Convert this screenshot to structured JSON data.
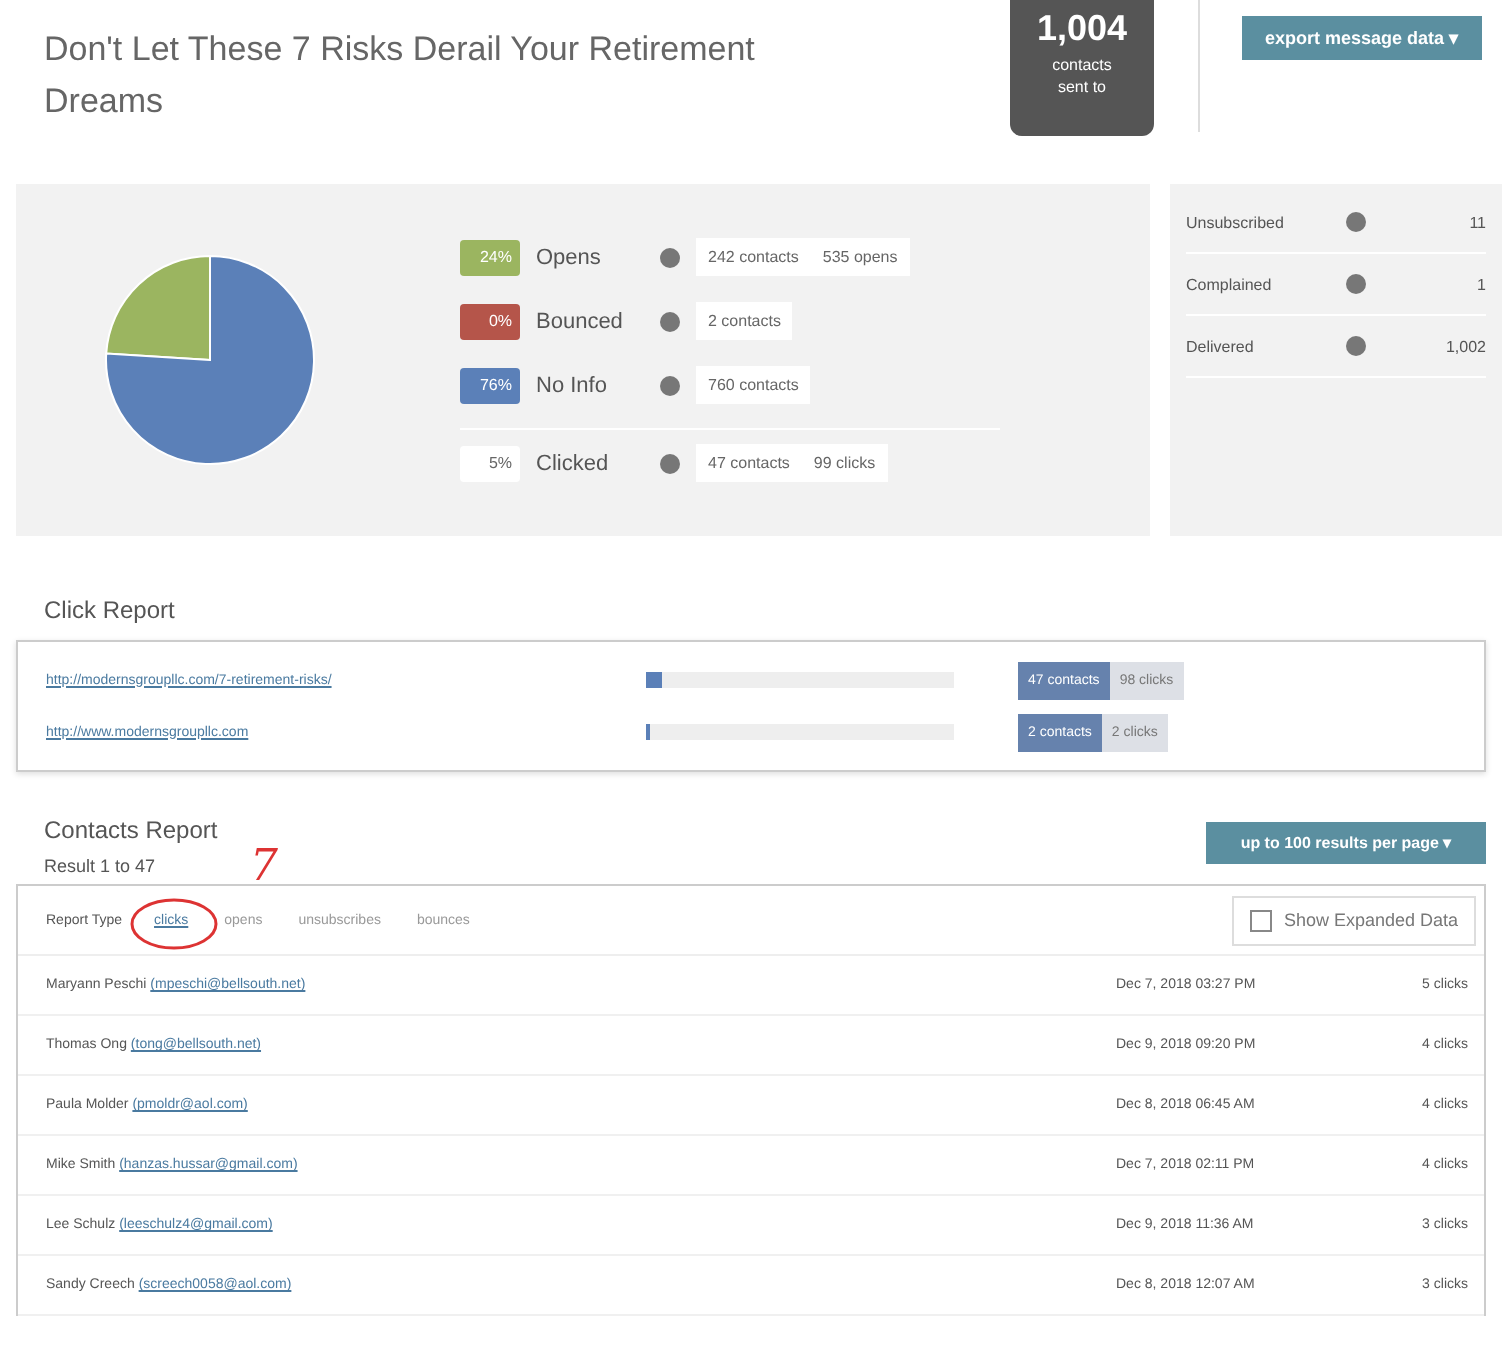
{
  "header": {
    "title": "Don't Let These 7 Risks Derail Your Retirement Dreams",
    "sent_count": "1,004",
    "sent_label": "contacts sent to",
    "export_button": "export message data ▾"
  },
  "stats": {
    "items": [
      {
        "kind": "segment",
        "badge": "24%",
        "label": "Opens",
        "color": "#9bb560",
        "chips": [
          "242 contacts",
          "535 opens"
        ]
      },
      {
        "kind": "segment",
        "badge": "0%",
        "label": "Bounced",
        "color": "#b5554a",
        "chips": [
          "2 contacts"
        ]
      },
      {
        "kind": "segment",
        "badge": "76%",
        "label": "No Info",
        "color": "#5b80b8",
        "chips": [
          "760 contacts"
        ]
      },
      {
        "kind": "extra",
        "badge": "5%",
        "label": "Clicked",
        "color": "#ffffff",
        "chips": [
          "47 contacts",
          "99 clicks"
        ]
      }
    ],
    "side": [
      {
        "label": "Unsubscribed",
        "value": "11"
      },
      {
        "label": "Complained",
        "value": "1"
      },
      {
        "label": "Delivered",
        "value": "1,002"
      }
    ]
  },
  "click_report": {
    "title": "Click Report",
    "rows": [
      {
        "url": "http://modernsgroupllc.com/7-retirement-risks/",
        "level": 0.05,
        "contacts": "47 contacts",
        "clicks": "98 clicks"
      },
      {
        "url": "http://www.modernsgroupllc.com",
        "level": 0.01,
        "contacts": "2 contacts",
        "clicks": "2 clicks"
      }
    ]
  },
  "contacts_report": {
    "title": "Contacts Report",
    "result": "Result 1 to 47",
    "per_page_button": "up to 100 results per page ▾",
    "report_type_label": "Report Type",
    "report_types": [
      {
        "label": "clicks",
        "selected": true
      },
      {
        "label": "opens",
        "selected": false
      },
      {
        "label": "unsubscribes",
        "selected": false
      },
      {
        "label": "bounces",
        "selected": false
      }
    ],
    "annotation": "7",
    "expanded": {
      "label": "Show Expanded Data",
      "checked": false
    },
    "rows": [
      {
        "name": "Maryann Peschi",
        "email": "(mpeschi@bellsouth.net)",
        "date": "Dec 7, 2018 03:27 PM",
        "count": "5 clicks"
      },
      {
        "name": "Thomas Ong",
        "email": "(tong@bellsouth.net)",
        "date": "Dec 9, 2018 09:20 PM",
        "count": "4 clicks"
      },
      {
        "name": "Paula Molder",
        "email": "(pmoldr@aol.com)",
        "date": "Dec 8, 2018 06:45 AM",
        "count": "4 clicks"
      },
      {
        "name": "Mike Smith",
        "email": "(hanzas.hussar@gmail.com)",
        "date": "Dec 7, 2018 02:11 PM",
        "count": "4 clicks"
      },
      {
        "name": "Lee Schulz",
        "email": "(leeschulz4@gmail.com)",
        "date": "Dec 9, 2018 11:36 AM",
        "count": "3 clicks"
      },
      {
        "name": "Sandy Creech",
        "email": "(screech0058@aol.com)",
        "date": "Dec 8, 2018 12:07 AM",
        "count": "3 clicks"
      }
    ]
  }
}
